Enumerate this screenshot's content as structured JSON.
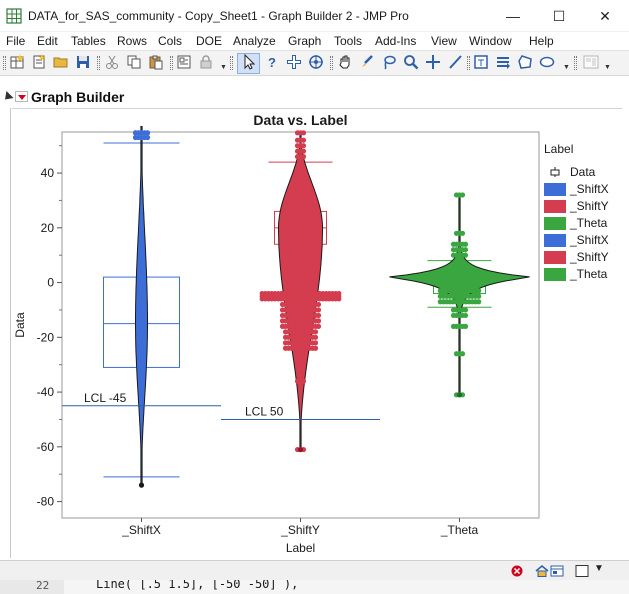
{
  "window": {
    "title": "DATA_for_SAS_community - Copy_Sheet1 - Graph Builder 2 - JMP Pro",
    "min_glyph": "—",
    "max_glyph": "☐",
    "close_glyph": "✕"
  },
  "menu": [
    "File",
    "Edit",
    "Tables",
    "Rows",
    "Cols",
    "DOE",
    "Analyze",
    "Graph",
    "Tools",
    "Add-Ins",
    "View",
    "Window",
    "Help"
  ],
  "toolbar": {
    "icons": [
      "new-data-table-icon",
      "new-script-icon",
      "open-icon",
      "save-icon",
      "cut-icon",
      "copy-icon",
      "paste-icon",
      "journal-icon",
      "lock-icon",
      "arrow-tool-icon",
      "help-tool-icon",
      "crosshair-tool-icon",
      "scroller-tool-icon",
      "grabber-tool-icon",
      "brush-tool-icon",
      "lasso-tool-icon",
      "magnifier-tool-icon",
      "crosshair-plus-icon",
      "line-tool-icon",
      "annotate-tool-icon",
      "polygon-tool-icon",
      "shape-tool-icon",
      "ellipse-tool-icon",
      "layout-icon"
    ]
  },
  "outline": {
    "title": "Graph Builder"
  },
  "chart_data": {
    "type": "box-violin",
    "title": "Data vs. Label",
    "xlabel": "Label",
    "ylabel": "Data",
    "categories": [
      "_ShiftX",
      "_ShiftY",
      "_Theta"
    ],
    "ylim": [
      -86,
      55
    ],
    "yticks": [
      40,
      20,
      0,
      -20,
      -40,
      -60,
      -80
    ],
    "grid": false,
    "legend_position": "right",
    "series": [
      {
        "name": "_ShiftX",
        "color": "#3d6ed8",
        "box": {
          "q1": -31,
          "median": -15,
          "q3": 2,
          "whisker_low": -71,
          "whisker_high": 51
        },
        "violin": {
          "min": -74,
          "max": 57,
          "mode": -15,
          "max_halfwidth": 6
        },
        "outliers": [
          53,
          55,
          57
        ],
        "limit": {
          "label": "LCL -45",
          "value": -45
        }
      },
      {
        "name": "_ShiftY",
        "color": "#d43d4f",
        "box": {
          "q1": 14,
          "median": 20,
          "q3": 26,
          "whisker_low": -5,
          "whisker_high": 44
        },
        "violin": {
          "min": -61,
          "max": 55,
          "mode": 20,
          "max_halfwidth": 22
        },
        "outliers": [
          46,
          48,
          50,
          52,
          55,
          -6,
          -8,
          -10,
          -12,
          -14,
          -16,
          -18,
          -20,
          -22,
          -24,
          -36,
          -61
        ],
        "limit": {
          "label": "LCL 50",
          "value": -50
        }
      },
      {
        "name": "_Theta",
        "color": "#3aa640",
        "box": {
          "q1": -4,
          "median": 1,
          "q3": 2,
          "whisker_low": -9,
          "whisker_high": 8
        },
        "violin": {
          "min": -41,
          "max": 32,
          "mode": 2,
          "max_halfwidth": 72
        },
        "outliers": [
          32,
          18,
          14,
          12,
          10,
          -10,
          -12,
          -16,
          -26,
          -41
        ]
      }
    ]
  },
  "legend": {
    "title": "Label",
    "items": [
      {
        "label": "Data",
        "kind": "box-marker"
      },
      {
        "label": "_ShiftX",
        "color": "#3d6ed8"
      },
      {
        "label": "_ShiftY",
        "color": "#d43d4f"
      },
      {
        "label": "_Theta",
        "color": "#3aa640"
      },
      {
        "label": "_ShiftX",
        "color": "#3d6ed8"
      },
      {
        "label": "_ShiftY",
        "color": "#d43d4f"
      },
      {
        "label": "_Theta",
        "color": "#3aa640"
      }
    ]
  },
  "peek": {
    "line_number": "22",
    "code": "Line( [.5 1.5], [-50 -50] ),"
  }
}
